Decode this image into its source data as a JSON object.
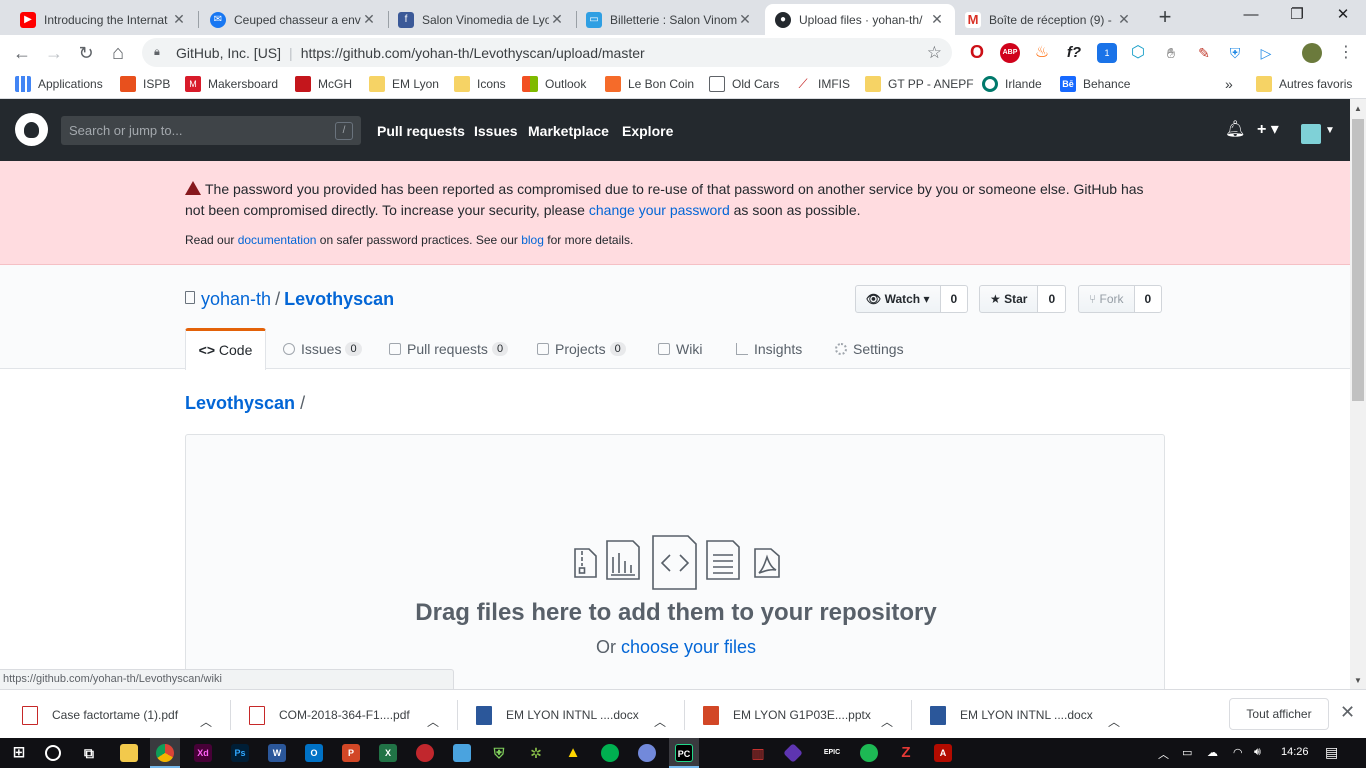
{
  "browser": {
    "tabs": [
      {
        "title": "Introducing the Internat",
        "color": "#ff0000",
        "glyph": "▶"
      },
      {
        "title": "Ceuped chasseur a envo",
        "color": "#1877f2",
        "glyph": "✉"
      },
      {
        "title": "Salon Vinomedia de Lyo",
        "color": "#3b5998",
        "glyph": "f"
      },
      {
        "title": "Billetterie : Salon Vinom",
        "color": "#2f9fe3",
        "glyph": "▭"
      },
      {
        "title": "Upload files · yohan-th/",
        "color": "#24292e",
        "glyph": "●"
      },
      {
        "title": "Boîte de réception (9) -",
        "color": "#d93025",
        "glyph": "M"
      }
    ],
    "new_tab": "+",
    "controls": {
      "minimize": "—",
      "maximize": "❐",
      "close": "✕"
    },
    "nav": {
      "back": "←",
      "forward": "→",
      "reload": "↻",
      "home": "⌂"
    },
    "address": {
      "org": "GitHub, Inc. [US]",
      "url": "https://github.com/yohan-th/Levothyscan/upload/master"
    },
    "bookmarks": [
      {
        "label": "Applications",
        "icon": "apps-icon"
      },
      {
        "label": "ISPB",
        "icon": "ispb-icon"
      },
      {
        "label": "Makersboard",
        "icon": "m-icon"
      },
      {
        "label": "McGH",
        "icon": "mcgh-icon"
      },
      {
        "label": "EM Lyon",
        "icon": "folder-icon"
      },
      {
        "label": "Icons",
        "icon": "folder-icon"
      },
      {
        "label": "Outlook",
        "icon": "outlook-icon"
      },
      {
        "label": "Le Bon Coin",
        "icon": "box-icon"
      },
      {
        "label": "Old Cars",
        "icon": "page-icon"
      },
      {
        "label": "IMFIS",
        "icon": "imfis-icon"
      },
      {
        "label": "GT PP - ANEPF",
        "icon": "folder-icon"
      },
      {
        "label": "Irlande",
        "icon": "circle-icon"
      },
      {
        "label": "Behance",
        "icon": "behance-icon"
      }
    ],
    "more": "»",
    "other_bookmarks": "Autres favoris",
    "status_url": "https://github.com/yohan-th/Levothyscan/wiki"
  },
  "github": {
    "search_placeholder": "Search or jump to...",
    "search_key": "/",
    "nav": [
      "Pull requests",
      "Issues",
      "Marketplace",
      "Explore"
    ],
    "plus": "+ ▾",
    "flash": {
      "text_1": "The password you provided has been reported as compromised due to re-use of that password on another service by you or someone else. GitHub has not been compromised directly. To increase your security, please ",
      "link_1": "change your password",
      "text_2": " as soon as possible.",
      "text_3": "Read our ",
      "link_2": "documentation",
      "text_4": " on safer password practices. See our ",
      "link_3": "blog",
      "text_5": " for more details."
    },
    "repo": {
      "owner": "yohan-th",
      "name": "Levothyscan",
      "watch": {
        "label": "Watch",
        "count": "0"
      },
      "star": {
        "label": "Star",
        "count": "0"
      },
      "fork": {
        "label": "Fork",
        "count": "0"
      }
    },
    "tabs": [
      {
        "label": "Code"
      },
      {
        "label": "Issues",
        "count": "0"
      },
      {
        "label": "Pull requests",
        "count": "0"
      },
      {
        "label": "Projects",
        "count": "0"
      },
      {
        "label": "Wiki"
      },
      {
        "label": "Insights"
      },
      {
        "label": "Settings"
      }
    ],
    "breadcrumb": {
      "repo": "Levothyscan",
      "sep": "/"
    },
    "dropzone": {
      "title": "Drag files here to add them to your repository",
      "or": "Or ",
      "choose": "choose your files"
    }
  },
  "downloads": [
    {
      "name": "Case factortame (1).pdf",
      "type": "pdf"
    },
    {
      "name": "COM-2018-364-F1....pdf",
      "type": "pdf"
    },
    {
      "name": "EM LYON INTNL ....docx",
      "type": "docx"
    },
    {
      "name": "EM LYON G1P03E....pptx",
      "type": "pptx"
    },
    {
      "name": "EM LYON INTNL ....docx",
      "type": "docx"
    }
  ],
  "downloads_show_all": "Tout afficher",
  "downloads_close": "✕",
  "taskbar": {
    "time": "14:26"
  }
}
